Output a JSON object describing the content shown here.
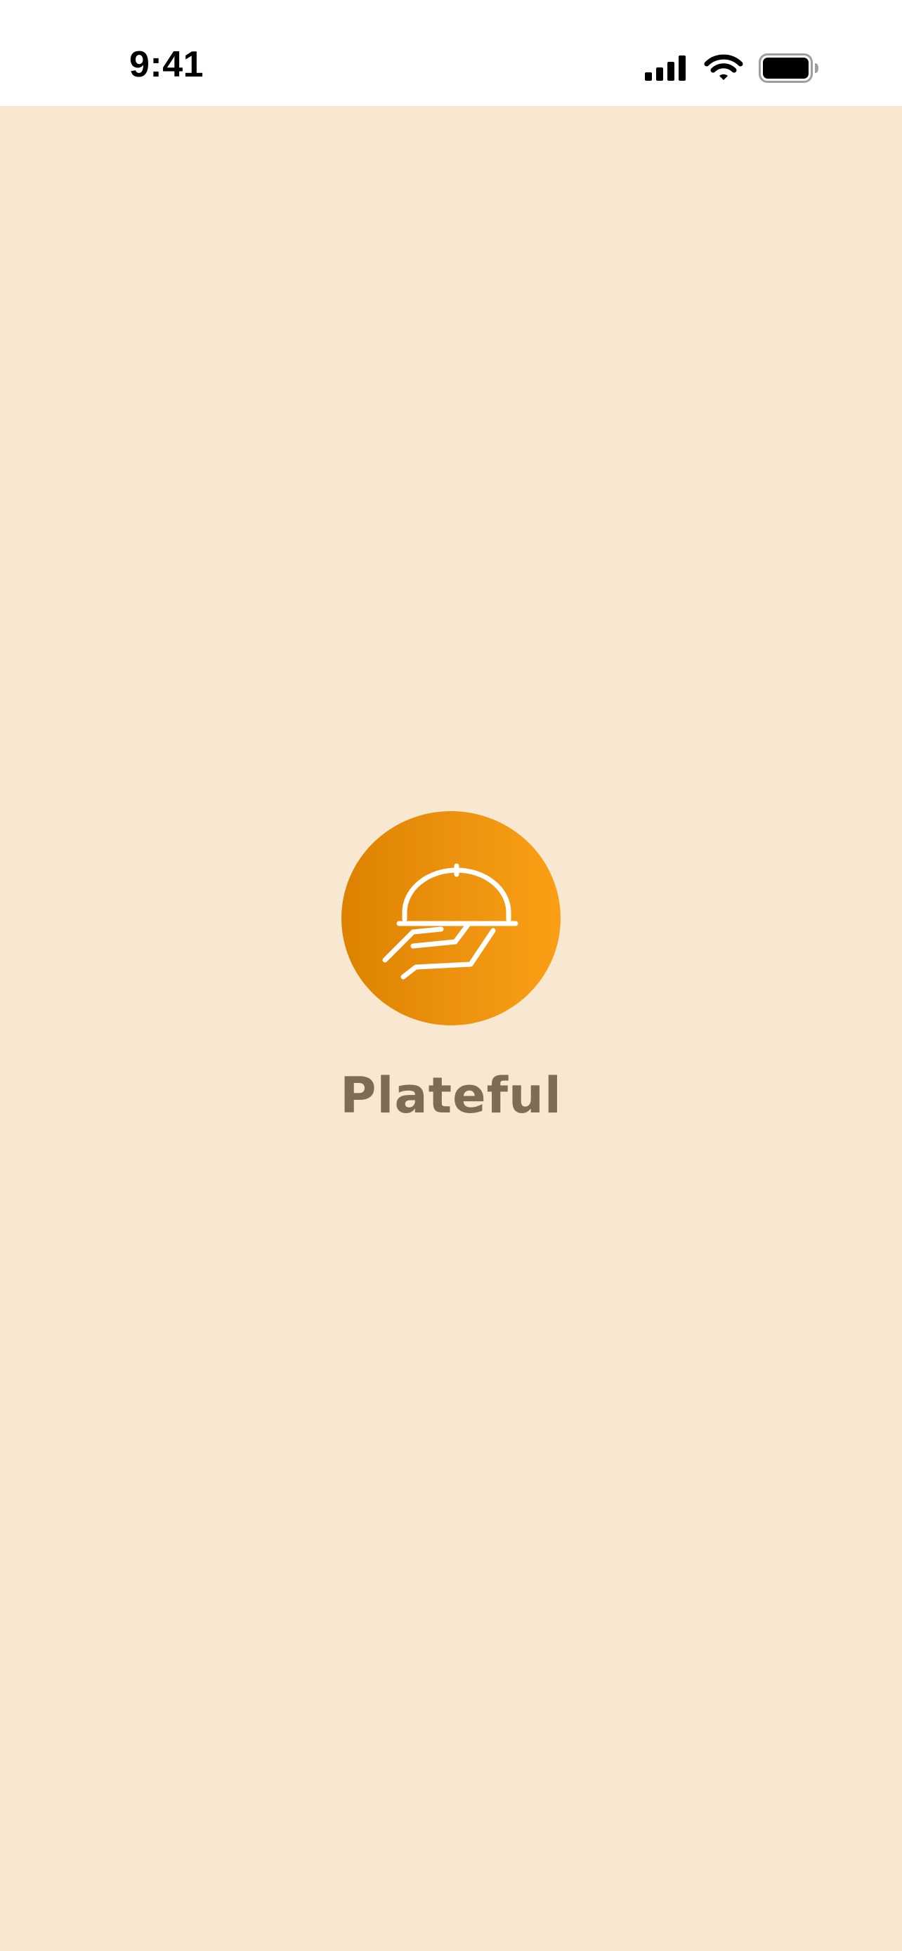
{
  "status_bar": {
    "time": "9:41",
    "icons": [
      "cellular-signal-icon",
      "wifi-icon",
      "battery-icon"
    ]
  },
  "splash": {
    "logo_icon": "serving-cloche-hand-icon",
    "app_name": "Plateful"
  },
  "colors": {
    "background": "#F8E8D1",
    "logo_gradient_start": "#DD8200",
    "logo_gradient_end": "#FA9F14",
    "app_name_text": "#7E6C55",
    "status_bar_background": "#FFFFFF"
  }
}
